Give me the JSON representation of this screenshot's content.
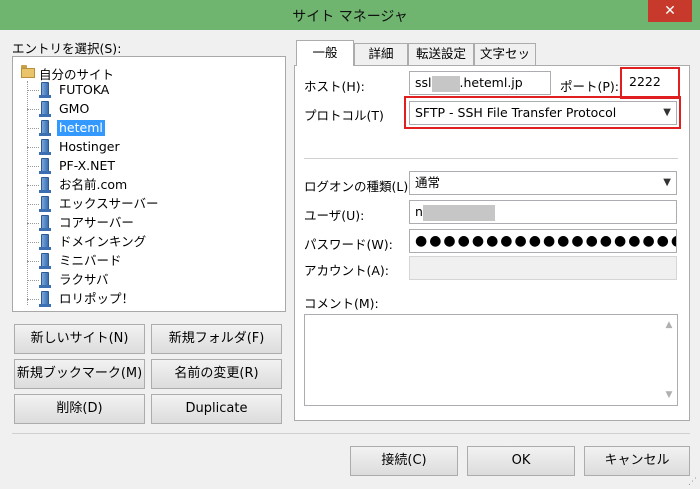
{
  "window": {
    "title": "サイト マネージャ",
    "close_label": "✕"
  },
  "tree": {
    "caption": "エントリを選択(S):",
    "root_label": "自分のサイト",
    "items": [
      {
        "label": "FUTOKA"
      },
      {
        "label": "GMO"
      },
      {
        "label": "heteml",
        "selected": true
      },
      {
        "label": "Hostinger"
      },
      {
        "label": "PF-X.NET"
      },
      {
        "label": "お名前.com"
      },
      {
        "label": "エックスサーバー"
      },
      {
        "label": "コアサーバー"
      },
      {
        "label": "ドメインキング"
      },
      {
        "label": "ミニバード"
      },
      {
        "label": "ラクサバ"
      },
      {
        "label": "ロリポップ！"
      }
    ]
  },
  "left_buttons": {
    "new_site": "新しいサイト(N)",
    "new_folder": "新規フォルダ(F)",
    "new_bookmark": "新規ブックマーク(M)",
    "rename": "名前の変更(R)",
    "delete": "削除(D)",
    "duplicate": "Duplicate"
  },
  "tabs": [
    {
      "label": "一般",
      "active": true
    },
    {
      "label": "詳細"
    },
    {
      "label": "転送設定"
    },
    {
      "label": "文字セット"
    }
  ],
  "general": {
    "host_label": "ホスト(H):",
    "host_value_prefix": "ssl",
    "host_value_suffix": ".heteml.jp",
    "port_label": "ポート(P):",
    "port_value": "2222",
    "protocol_label": "プロトコル(T)",
    "protocol_value": "SFTP - SSH File Transfer Protocol",
    "logon_label": "ログオンの種類(L):",
    "logon_value": "通常",
    "user_label": "ユーザ(U):",
    "user_value_prefix": "n",
    "password_label": "パスワード(W):",
    "password_value": "●●●●●●●●●●●●●●●●●●●●",
    "account_label": "アカウント(A):",
    "comment_label": "コメント(M):"
  },
  "bottom_buttons": {
    "connect": "接続(C)",
    "ok": "OK",
    "cancel": "キャンセル"
  },
  "colors": {
    "titlebar": "#6fb46f",
    "selection": "#3399ff",
    "highlight": "#e02020",
    "close": "#c7392b"
  }
}
